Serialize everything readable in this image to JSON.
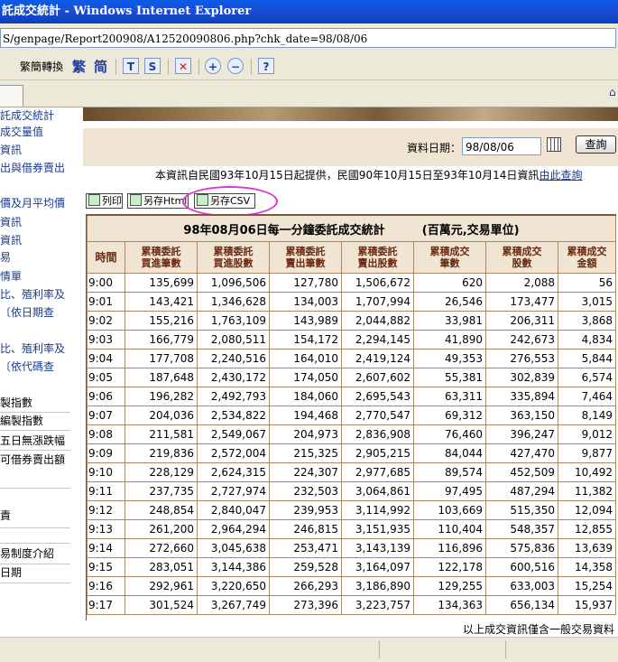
{
  "window": {
    "title": "託成交統計 - Windows Internet Explorer",
    "address": "S/genpage/Report200908/A12520090806.php?chk_date=98/08/06"
  },
  "toolbar": {
    "convert_label": "繁簡轉換",
    "trad_label": "繁",
    "simp_label": "简",
    "page_label": "?"
  },
  "sidebar": {
    "items": [
      "託成交統計",
      "成交量值",
      "資訊",
      "出與借券賣出",
      "價及月平均價",
      "資訊",
      "資訊",
      "易",
      "情單",
      "比、殖利率及",
      "〔依日期查",
      "比、殖利率及",
      "〔依代碼查",
      "製指數",
      "編製指數",
      "五日無漲跌幅",
      "可借券賣出額",
      "責",
      "易制度介紹",
      "日期"
    ]
  },
  "datebar": {
    "label": "資料日期：",
    "date_value": "98/08/06",
    "query_button": "查詢"
  },
  "notice": {
    "text": "本資訊自民國93年10月15日起提供，民國90年10月15日至93年10月14日資訊",
    "link": "由此查詢"
  },
  "actions": {
    "print": "列印",
    "save_html": "另存Html",
    "save_csv": "另存CSV"
  },
  "table": {
    "caption_title": "98年08月06日每一分鐘委託成交統計",
    "caption_unit": "(百萬元,交易單位)",
    "headers": [
      "時間",
      "累積委託\n買進筆數",
      "累積委託\n買進股數",
      "累積委託\n賣出筆數",
      "累積委託\n賣出股數",
      "累積成交\n筆數",
      "累積成交\n股數",
      "累積成交\n金額"
    ],
    "rows": [
      [
        "9:00",
        "135,699",
        "1,096,506",
        "127,780",
        "1,506,672",
        "620",
        "2,088",
        "56"
      ],
      [
        "9:01",
        "143,421",
        "1,346,628",
        "134,003",
        "1,707,994",
        "26,546",
        "173,477",
        "3,015"
      ],
      [
        "9:02",
        "155,216",
        "1,763,109",
        "143,989",
        "2,044,882",
        "33,981",
        "206,311",
        "3,868"
      ],
      [
        "9:03",
        "166,779",
        "2,080,511",
        "154,172",
        "2,294,145",
        "41,890",
        "242,673",
        "4,834"
      ],
      [
        "9:04",
        "177,708",
        "2,240,516",
        "164,010",
        "2,419,124",
        "49,353",
        "276,553",
        "5,844"
      ],
      [
        "9:05",
        "187,648",
        "2,430,172",
        "174,050",
        "2,607,602",
        "55,381",
        "302,839",
        "6,574"
      ],
      [
        "9:06",
        "196,282",
        "2,492,793",
        "184,060",
        "2,695,543",
        "63,311",
        "335,894",
        "7,464"
      ],
      [
        "9:07",
        "204,036",
        "2,534,822",
        "194,468",
        "2,770,547",
        "69,312",
        "363,150",
        "8,149"
      ],
      [
        "9:08",
        "211,581",
        "2,549,067",
        "204,973",
        "2,836,908",
        "76,460",
        "396,247",
        "9,012"
      ],
      [
        "9:09",
        "219,836",
        "2,572,004",
        "215,325",
        "2,905,215",
        "84,044",
        "427,470",
        "9,877"
      ],
      [
        "9:10",
        "228,129",
        "2,624,315",
        "224,307",
        "2,977,685",
        "89,574",
        "452,509",
        "10,492"
      ],
      [
        "9:11",
        "237,735",
        "2,727,974",
        "232,503",
        "3,064,861",
        "97,495",
        "487,294",
        "11,382"
      ],
      [
        "9:12",
        "248,854",
        "2,840,047",
        "239,953",
        "3,114,992",
        "103,669",
        "515,350",
        "12,094"
      ],
      [
        "9:13",
        "261,200",
        "2,964,294",
        "246,815",
        "3,151,935",
        "110,404",
        "548,357",
        "12,855"
      ],
      [
        "9:14",
        "272,660",
        "3,045,638",
        "253,471",
        "3,143,139",
        "116,896",
        "575,836",
        "13,639"
      ],
      [
        "9:15",
        "283,051",
        "3,144,386",
        "259,528",
        "3,164,097",
        "122,178",
        "600,516",
        "14,358"
      ],
      [
        "9:16",
        "292,961",
        "3,220,650",
        "266,293",
        "3,186,890",
        "129,255",
        "633,003",
        "15,254"
      ],
      [
        "9:17",
        "301,524",
        "3,267,749",
        "273,396",
        "3,223,757",
        "134,363",
        "656,134",
        "15,937"
      ]
    ]
  },
  "footer": {
    "text": "以上成交資訊僅含一般交易資料"
  },
  "colors": {
    "header_bg": "#f0e4d2",
    "header_text": "#6b2a12",
    "link": "#1b3a8c",
    "highlight_ring": "#e034d6"
  }
}
